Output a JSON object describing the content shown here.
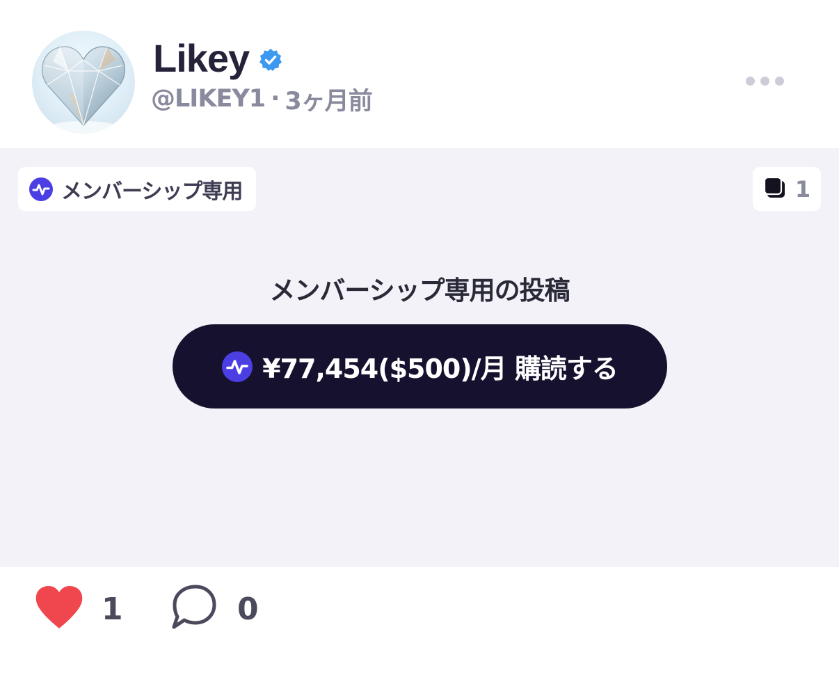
{
  "author": {
    "display_name": "Likey",
    "verified": true,
    "handle": "@LIKEY1",
    "separator": "·",
    "posted_ago": "3ヶ月前",
    "avatar_icon": "crystal-heart-avatar"
  },
  "header": {
    "more_icon": "more-horizontal-icon"
  },
  "content": {
    "membership_tag": "メンバーシップ専用",
    "media_count": "1",
    "media_icon": "media-stack-icon",
    "locked_title": "メンバーシップ専用の投稿",
    "subscribe_label": "¥77,454($500)/月 購読する",
    "pulse_icon": "pulse-icon"
  },
  "actions": {
    "like_count": "1",
    "comment_count": "0",
    "like_icon": "heart-icon",
    "comment_icon": "speech-bubble-icon"
  },
  "colors": {
    "accent": "#4b3fe4",
    "button_bg": "#16112e",
    "heart": "#f0474f",
    "verified": "#3b99f0",
    "content_bg": "#f2f2f8"
  }
}
